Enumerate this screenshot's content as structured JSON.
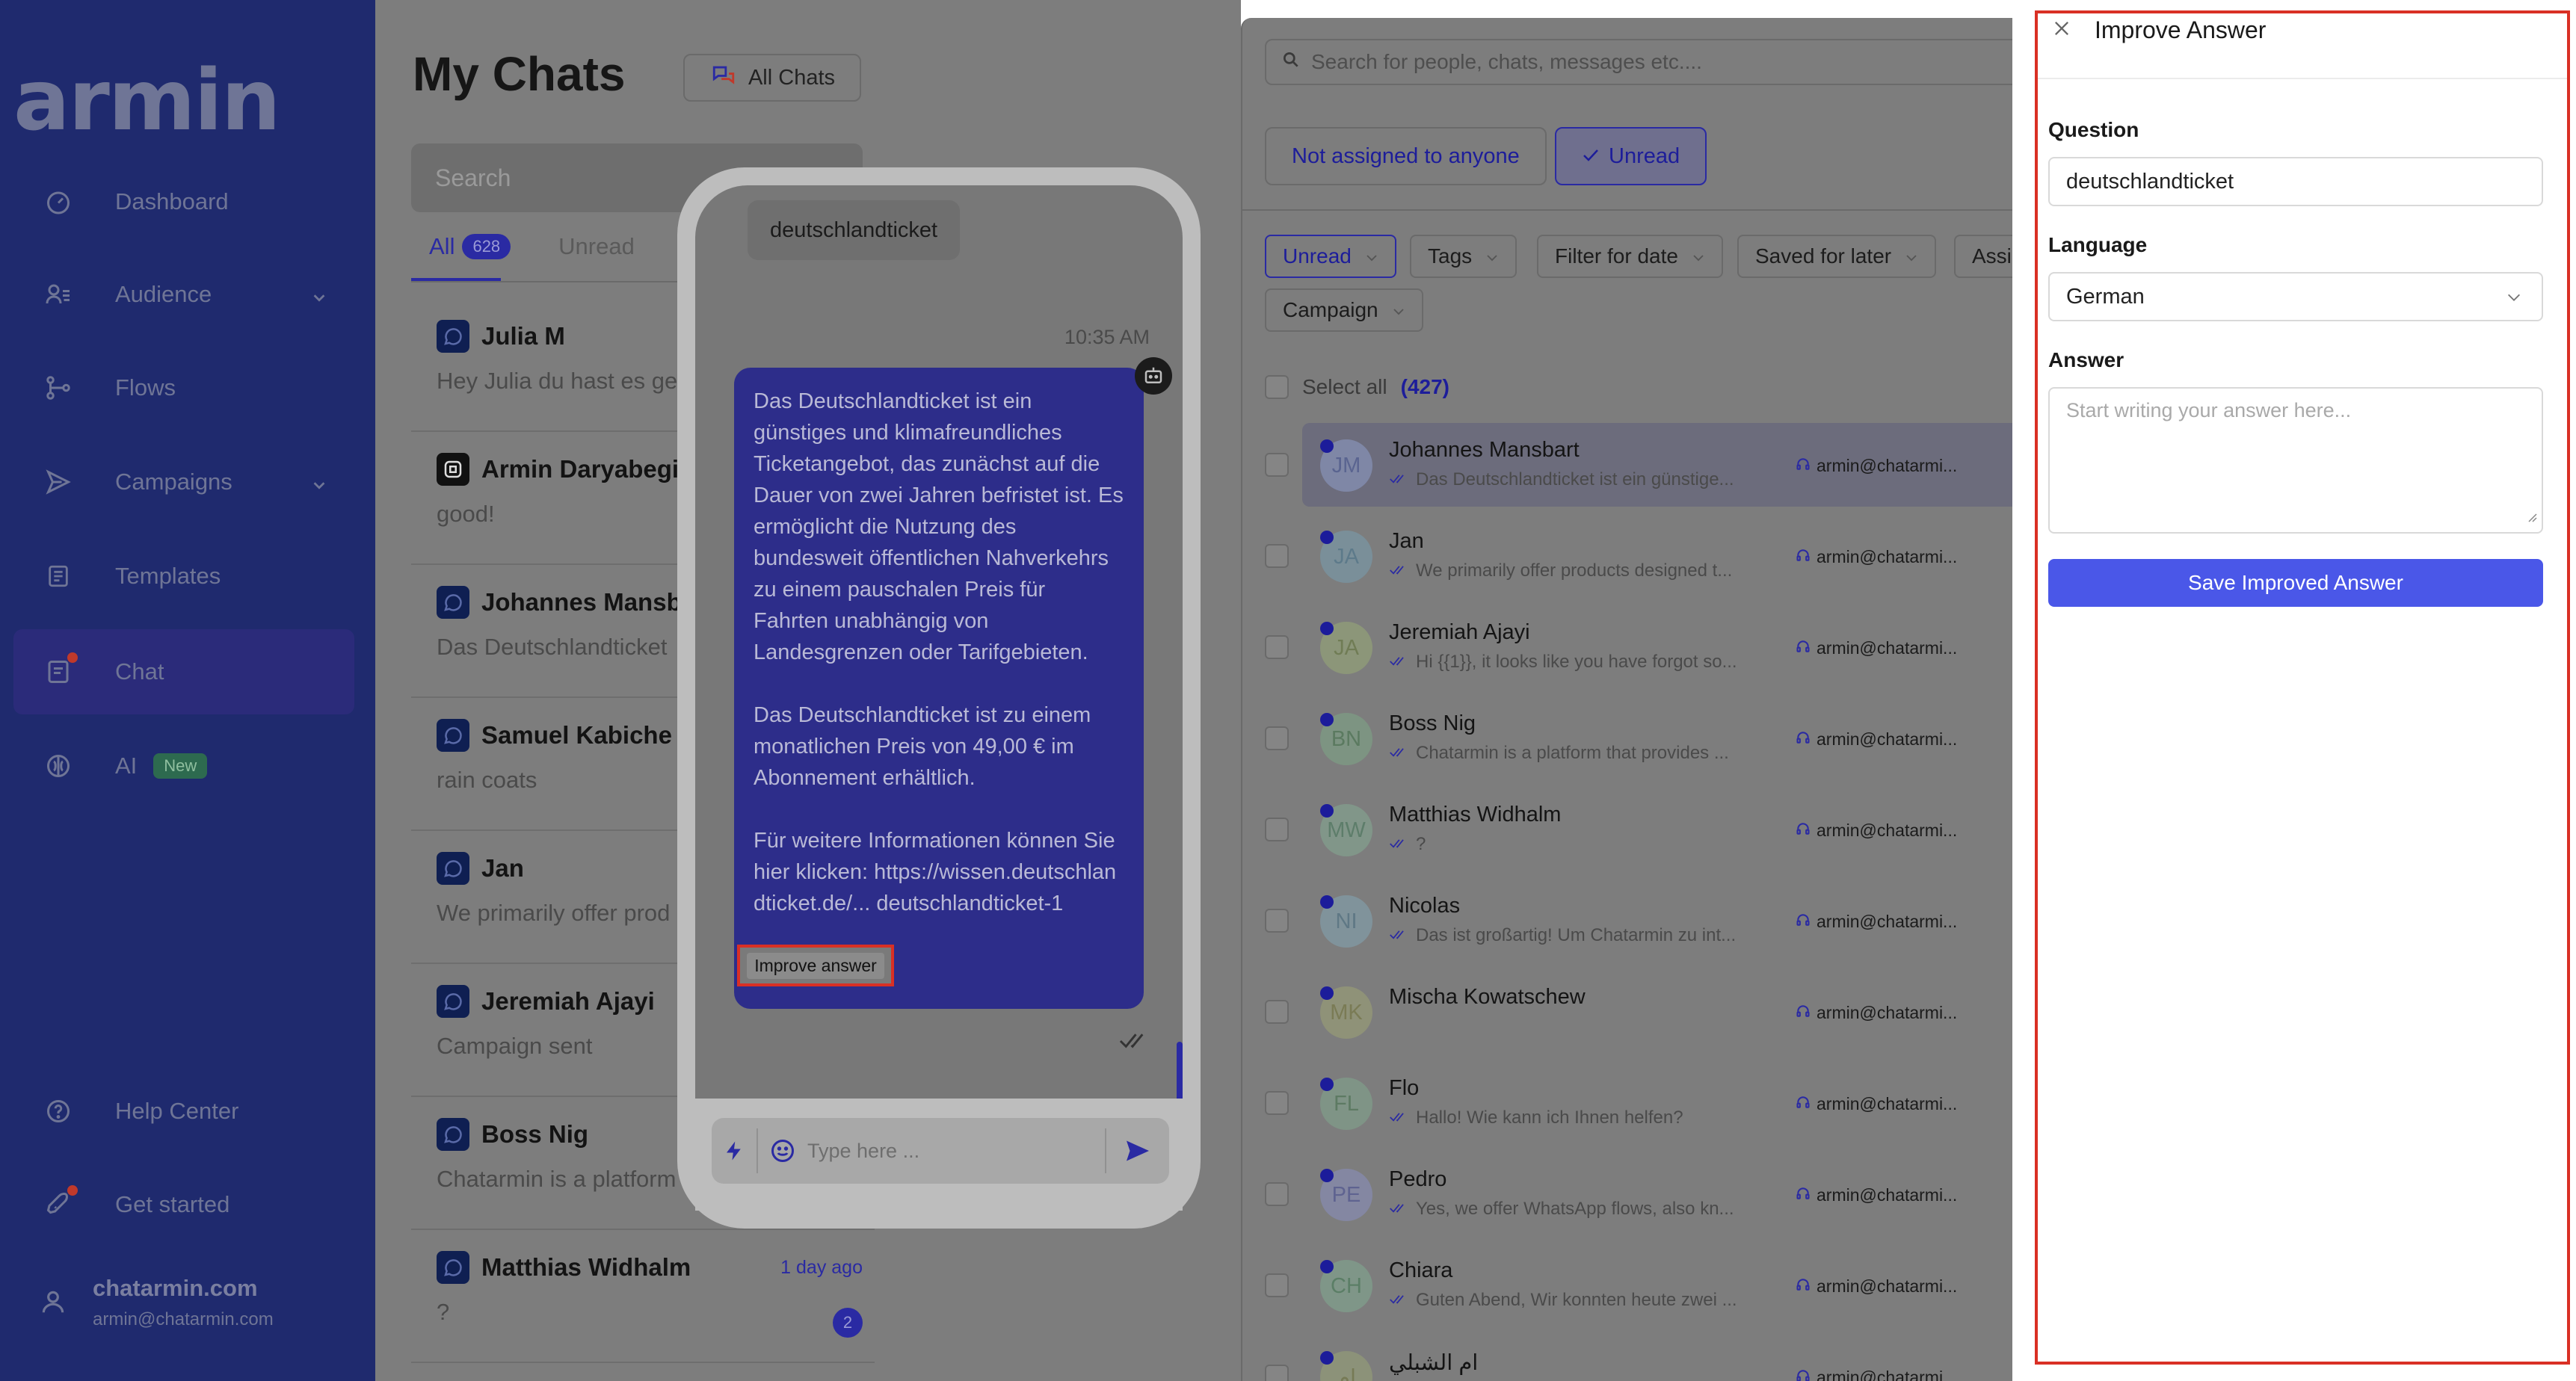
{
  "sidebar": {
    "logo": "armin",
    "items": [
      {
        "label": "Dashboard",
        "icon": "gauge-icon"
      },
      {
        "label": "Audience",
        "icon": "users-icon"
      },
      {
        "label": "Flows",
        "icon": "flow-icon"
      },
      {
        "label": "Campaigns",
        "icon": "send-icon"
      },
      {
        "label": "Templates",
        "icon": "template-icon"
      },
      {
        "label": "Chat",
        "icon": "chat-icon"
      },
      {
        "label": "AI",
        "icon": "ai-icon",
        "badge": "New"
      },
      {
        "label": "Help Center",
        "icon": "help-icon"
      },
      {
        "label": "Get started",
        "icon": "rocket-icon"
      }
    ],
    "account": {
      "name": "chatarmin.com",
      "email": "armin@chatarmin.com"
    }
  },
  "chatlist": {
    "title": "My Chats",
    "all_chats_label": "All Chats",
    "search_placeholder": "Search",
    "tabs": [
      {
        "label": "All",
        "count": "628"
      },
      {
        "label": "Unread"
      }
    ],
    "items": [
      {
        "name": "Julia M",
        "message": "Hey Julia du hast es ge"
      },
      {
        "name": "Armin Daryabegi",
        "message": "good!"
      },
      {
        "name": "Johannes Mansb",
        "message": "Das Deutschlandticket"
      },
      {
        "name": "Samuel Kabiche",
        "message": "rain coats"
      },
      {
        "name": "Jan",
        "message": "We primarily offer prod"
      },
      {
        "name": "Jeremiah Ajayi",
        "message": "Campaign sent"
      },
      {
        "name": "Boss Nig",
        "message": "Chatarmin is a platform"
      },
      {
        "name": "Matthias Widhalm",
        "message": "?",
        "time": "1 day ago",
        "unread": "2"
      }
    ]
  },
  "preview": {
    "question": "deutschlandticket",
    "time": "10:35 AM",
    "answer_paragraphs": [
      "Das Deutschlandticket ist ein günstiges und klimafreundliches Ticketangebot, das zunächst auf die Dauer von zwei Jahren befristet ist. Es ermöglicht die Nutzung des bundesweit öffentlichen Nahverkehrs zu einem pauschalen Preis für Fahrten unabhängig von Landesgrenzen oder Tarifgebieten.",
      "Das Deutschlandticket ist zu einem monatlichen Preis von 49,00 € im Abonnement erhältlich.",
      "Für weitere Informationen können Sie hier klicken: https://wissen.deutschlandticket.de/... deutschlandticket-1"
    ],
    "improve_button": "Improve answer",
    "composer_placeholder": "Type here ..."
  },
  "inbox": {
    "search_placeholder": "Search for people, chats, messages etc....",
    "segments": [
      "Not assigned to anyone",
      "Unread"
    ],
    "filters": [
      "Unread",
      "Tags",
      "Filter for date",
      "Saved for later",
      "Assi",
      "Campaign"
    ],
    "select_all_label": "Select all",
    "select_all_count": "(427)",
    "rows": [
      {
        "initials": "JM",
        "name": "Johannes Mansbart",
        "message": "Das Deutschlandticket ist ein günstige...",
        "agent": "armin@chatarmi...",
        "avatar_color": "#7f87a6",
        "text_color": "#5a6490",
        "selected": true
      },
      {
        "initials": "JA",
        "name": "Jan",
        "message": "We primarily offer products designed t...",
        "agent": "armin@chatarmi...",
        "avatar_color": "#7a8f99",
        "text_color": "#5d7a8a"
      },
      {
        "initials": "JA",
        "name": "Jeremiah Ajayi",
        "message": "Hi {{1}}, it looks like you have forgot so...",
        "agent": "armin@chatarmi...",
        "avatar_color": "#8c9679",
        "text_color": "#707c55"
      },
      {
        "initials": "BN",
        "name": "Boss Nig",
        "message": "Chatarmin is a platform that provides ...",
        "agent": "armin@chatarmi...",
        "avatar_color": "#7d9482",
        "text_color": "#5b7a60"
      },
      {
        "initials": "MW",
        "name": "Matthias Widhalm",
        "message": "?",
        "agent": "armin@chatarmi...",
        "avatar_color": "#819689",
        "text_color": "#5d7d6a"
      },
      {
        "initials": "NI",
        "name": "Nicolas",
        "message": "Das ist großartig! Um Chatarmin zu int...",
        "agent": "armin@chatarmi...",
        "avatar_color": "#80939b",
        "text_color": "#5f7885"
      },
      {
        "initials": "MK",
        "name": "Mischa Kowatschew",
        "message": "",
        "agent": "armin@chatarmi...",
        "avatar_color": "#8f9278",
        "text_color": "#7a7b55"
      },
      {
        "initials": "FL",
        "name": "Flo",
        "message": "Hallo! Wie kann ich Ihnen helfen?",
        "agent": "armin@chatarmi...",
        "avatar_color": "#7f9486",
        "text_color": "#5d7a63"
      },
      {
        "initials": "PE",
        "name": "Pedro",
        "message": "Yes, we offer WhatsApp flows, also kn...",
        "agent": "armin@chatarmi...",
        "avatar_color": "#8487a2",
        "text_color": "#5f6390"
      },
      {
        "initials": "CH",
        "name": "Chiara",
        "message": "Guten Abend, Wir konnten heute zwei ...",
        "agent": "armin@chatarmi...",
        "avatar_color": "#7f9688",
        "text_color": "#5b7e66"
      },
      {
        "initials": "ام",
        "name": "ام الشبلي",
        "message": "",
        "agent": "armin@chatarmi...",
        "avatar_color": "#8c9279",
        "text_color": "#767a55"
      }
    ]
  },
  "panel": {
    "title": "Improve Answer",
    "question_label": "Question",
    "question_value": "deutschlandticket",
    "language_label": "Language",
    "language_value": "German",
    "answer_label": "Answer",
    "answer_placeholder": "Start writing your answer here...",
    "save_label": "Save Improved Answer"
  },
  "colors": {
    "accent": "#4a57e8",
    "highlight": "#d93025",
    "sidebar": "#1f2a6e"
  }
}
